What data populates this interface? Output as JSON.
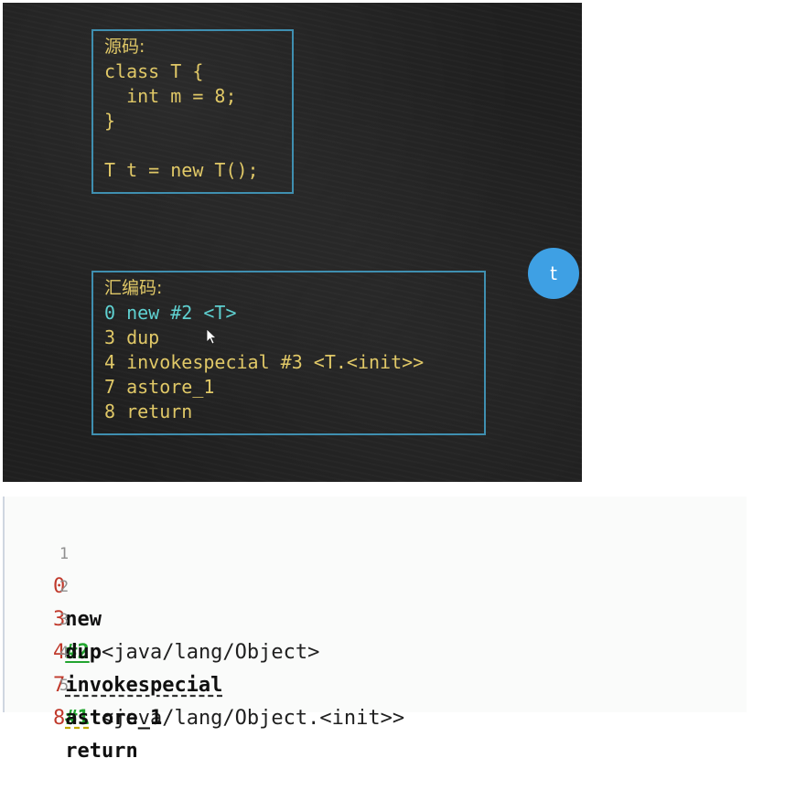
{
  "slide": {
    "source_box": {
      "label": "源码:",
      "lines": [
        "class T {",
        "  int m = 8;",
        "}",
        "",
        "T t = new T();"
      ]
    },
    "asm_box": {
      "label": "汇编码:",
      "lines": [
        "0 new #2 <T>",
        "3 dup",
        "4 invokespecial #3 <T.<init>>",
        "7 astore_1",
        "8 return"
      ]
    },
    "avatar_letter": "t"
  },
  "editor": {
    "lines": [
      {
        "num": "1",
        "offset": "0",
        "op": "new",
        "ref": "#2",
        "arg": " <java/lang/Object>"
      },
      {
        "num": "2",
        "offset": "3",
        "op": "dup",
        "ref": "",
        "arg": ""
      },
      {
        "num": "3",
        "offset": "4",
        "op": "invokespecial",
        "ref": "#1",
        "arg": " <java/lang/Object.<init>>"
      },
      {
        "num": "4",
        "offset": "7",
        "op": "astore_1",
        "ref": "",
        "arg": ""
      },
      {
        "num": "5",
        "offset": "8",
        "op": "return",
        "ref": "",
        "arg": ""
      }
    ]
  },
  "colors": {
    "slide_text": "#e0c867",
    "slide_highlight": "#5fd1d1",
    "box_border": "#3f8fb0",
    "avatar": "#3ea0e4",
    "offset": "#c0392b",
    "ref": "#22a52f"
  }
}
